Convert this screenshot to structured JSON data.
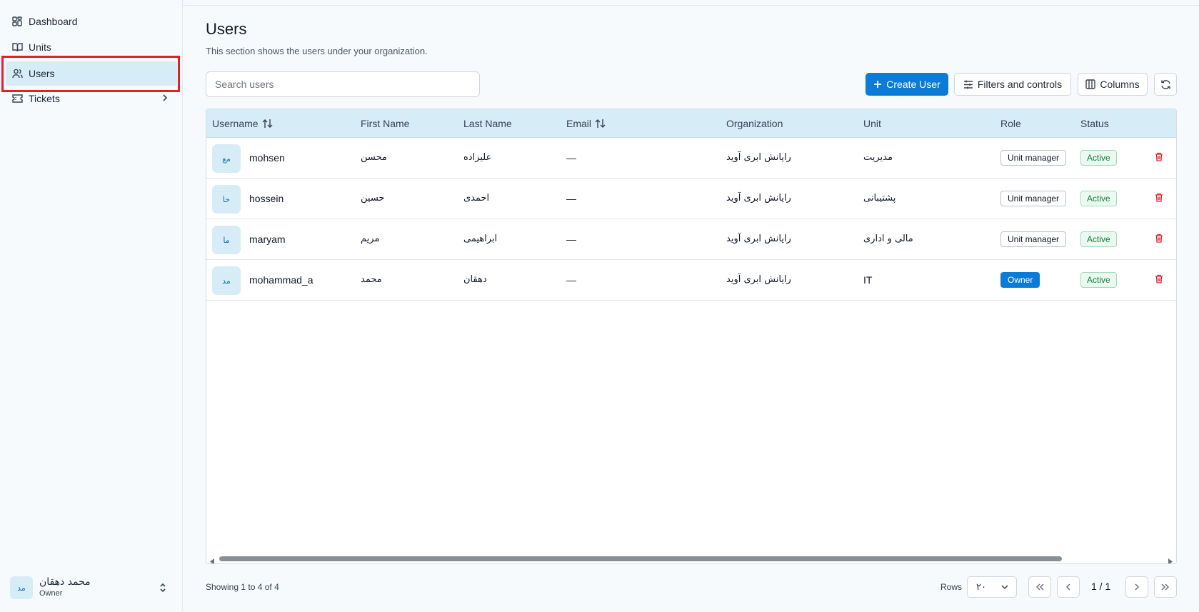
{
  "sidebar": {
    "items": [
      {
        "label": "Dashboard",
        "icon": "dashboard-icon"
      },
      {
        "label": "Units",
        "icon": "book-icon"
      },
      {
        "label": "Users",
        "icon": "users-icon",
        "active": true
      },
      {
        "label": "Tickets",
        "icon": "ticket-icon"
      }
    ],
    "user": {
      "initials": "مد",
      "name": "محمد دهقان",
      "role": "Owner"
    }
  },
  "header": {
    "title": "Users",
    "subtitle": "This section shows the users under your organization."
  },
  "toolbar": {
    "search_placeholder": "Search users",
    "create_label": "Create User",
    "filters_label": "Filters and controls",
    "columns_label": "Columns"
  },
  "table": {
    "columns": [
      "Username",
      "First Name",
      "Last Name",
      "Email",
      "Organization",
      "Unit",
      "Role",
      "Status"
    ],
    "rows": [
      {
        "initials": "مع",
        "username": "mohsen",
        "first": "محسن",
        "last": "علیزاده",
        "email": "—",
        "org": "رایانش ابری آوید",
        "unit": "مدیریت",
        "role": "Unit manager",
        "status": "Active"
      },
      {
        "initials": "حا",
        "username": "hossein",
        "first": "حسین",
        "last": "احمدی",
        "email": "—",
        "org": "رایانش ابری آوید",
        "unit": "پشتیبانی",
        "role": "Unit manager",
        "status": "Active"
      },
      {
        "initials": "ما",
        "username": "maryam",
        "first": "مریم",
        "last": "ابراهیمی",
        "email": "—",
        "org": "رایانش ابری آوید",
        "unit": "مالی و اداری",
        "role": "Unit manager",
        "status": "Active"
      },
      {
        "initials": "مد",
        "username": "mohammad_a",
        "first": "محمد",
        "last": "دهقان",
        "email": "—",
        "org": "رایانش ابری آوید",
        "unit": "IT",
        "role": "Owner",
        "status": "Active"
      }
    ]
  },
  "footer": {
    "showing": "Showing 1 to 4 of 4",
    "rows_label": "Rows",
    "rows_value": "۲۰",
    "page": "1 / 1"
  },
  "colors": {
    "accent": "#0b7bd6",
    "header_bg": "#d6ecf7",
    "active_green": "#15803d",
    "danger": "#e3202a"
  }
}
